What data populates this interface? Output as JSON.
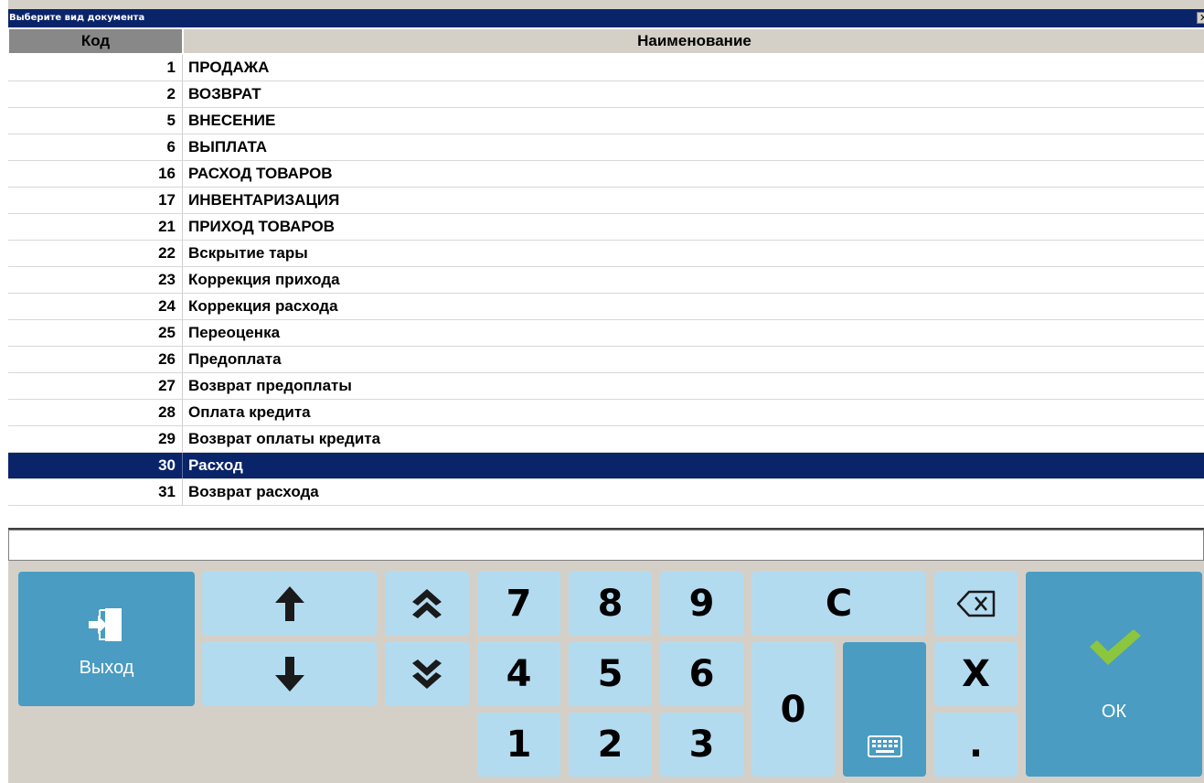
{
  "window": {
    "title": "Выберите вид документа",
    "close_glyph": "✕"
  },
  "grid": {
    "columns": {
      "code": "Код",
      "name": "Наименование"
    },
    "rows": [
      {
        "code": "1",
        "name": "ПРОДАЖА"
      },
      {
        "code": "2",
        "name": "ВОЗВРАТ"
      },
      {
        "code": "5",
        "name": "ВНЕСЕНИЕ"
      },
      {
        "code": "6",
        "name": "ВЫПЛАТА"
      },
      {
        "code": "16",
        "name": "РАСХОД ТОВАРОВ"
      },
      {
        "code": "17",
        "name": "ИНВЕНТАРИЗАЦИЯ"
      },
      {
        "code": "21",
        "name": "ПРИХОД ТОВАРОВ"
      },
      {
        "code": "22",
        "name": "Вскрытие тары"
      },
      {
        "code": "23",
        "name": "Коррекция прихода"
      },
      {
        "code": "24",
        "name": "Коррекция расхода"
      },
      {
        "code": "25",
        "name": "Переоценка"
      },
      {
        "code": "26",
        "name": "Предоплата"
      },
      {
        "code": "27",
        "name": "Возврат предоплаты"
      },
      {
        "code": "28",
        "name": "Оплата кредита"
      },
      {
        "code": "29",
        "name": "Возврат оплаты кредита"
      },
      {
        "code": "30",
        "name": "Расход",
        "selected": true
      },
      {
        "code": "31",
        "name": "Возврат расхода"
      }
    ]
  },
  "input": {
    "value": ""
  },
  "keypad": {
    "exit_label": "Выход",
    "ok_label": "ОК",
    "clear_label": "C",
    "x_label": "X",
    "dot_label": ".",
    "digits": {
      "d0": "0",
      "d1": "1",
      "d2": "2",
      "d3": "3",
      "d4": "4",
      "d5": "5",
      "d6": "6",
      "d7": "7",
      "d8": "8",
      "d9": "9"
    }
  },
  "colors": {
    "title_bar": "#0a246a",
    "selection": "#0a246a",
    "key_light": "#b3dbf0",
    "key_dark": "#4a9cc2",
    "check_green": "#8cc63f"
  }
}
